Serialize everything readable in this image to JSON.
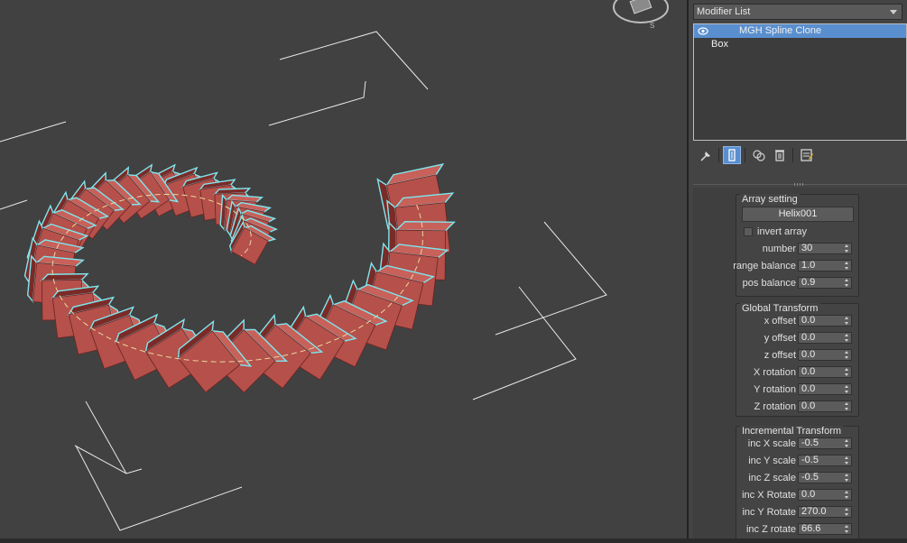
{
  "modifier_list": {
    "label": "Modifier List"
  },
  "stack": {
    "items": [
      {
        "label": "MGH Spline Clone",
        "selected": true
      },
      {
        "label": "Box",
        "selected": false
      }
    ]
  },
  "toolbar_icons": [
    "pin-stack-icon",
    "show-end-result-icon",
    "make-unique-icon",
    "remove-modifier-icon",
    "configure-modifier-sets-icon"
  ],
  "array_setting": {
    "title": "Array setting",
    "pick_button": "Helix001",
    "invert_label": "invert array",
    "number_label": "number",
    "number_value": "30",
    "range_label": "range balance",
    "range_value": "1.0",
    "pos_label": "pos balance",
    "pos_value": "0.9"
  },
  "global_transform": {
    "title": "Global Transform",
    "params": [
      {
        "label": "x offset",
        "value": "0.0"
      },
      {
        "label": "y offset",
        "value": "0.0"
      },
      {
        "label": "z offset",
        "value": "0.0"
      },
      {
        "label": "X rotation",
        "value": "0.0"
      },
      {
        "label": "Y rotation",
        "value": "0.0"
      },
      {
        "label": "Z rotation",
        "value": "0.0"
      }
    ]
  },
  "incremental_transform": {
    "title": "Incremental Transform",
    "params": [
      {
        "label": "inc X scale",
        "value": "-0.5"
      },
      {
        "label": "inc Y scale",
        "value": "-0.5"
      },
      {
        "label": "inc Z scale",
        "value": "-0.5"
      },
      {
        "label": "inc X Rotate",
        "value": "0.0"
      },
      {
        "label": "inc Y Rotate",
        "value": "270.0"
      },
      {
        "label": "inc Z rotate",
        "value": "66.6"
      }
    ]
  },
  "colors": {
    "selection": "#5a8fcf",
    "box_face": "#b5504a",
    "outline": "#7fe6ee",
    "spline": "#e8d8a0",
    "viewport_bg": "#414141"
  }
}
